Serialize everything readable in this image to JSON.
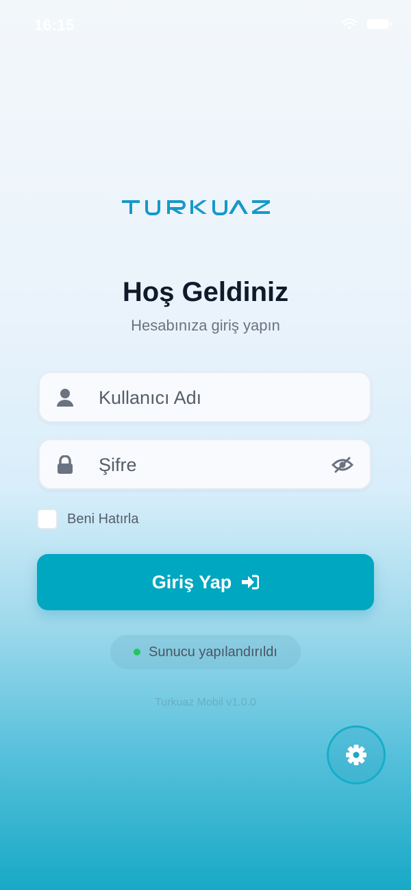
{
  "status_bar": {
    "time": "16:15"
  },
  "brand": {
    "logo_text": "TURKUAZ",
    "color": "#1599c8"
  },
  "welcome": {
    "title": "Hoş Geldiniz",
    "subtitle": "Hesabınıza giriş yapın"
  },
  "form": {
    "username": {
      "placeholder": "Kullanıcı Adı",
      "value": "",
      "icon": "user-icon"
    },
    "password": {
      "placeholder": "Şifre",
      "value": "",
      "icon": "lock-icon",
      "toggle_icon": "eye-slash-icon"
    },
    "remember_me": {
      "label": "Beni Hatırla",
      "checked": false
    },
    "submit": {
      "label": "Giriş Yap",
      "icon": "sign-in-icon"
    }
  },
  "server_status": {
    "text": "Sunucu yapılandırıldı",
    "status_color": "#22c55e"
  },
  "footer": {
    "version": "Turkuaz Mobil v1.0.0"
  },
  "settings": {
    "icon": "gear-icon"
  },
  "colors": {
    "accent": "#00a7c1",
    "title": "#0f1a2a"
  }
}
